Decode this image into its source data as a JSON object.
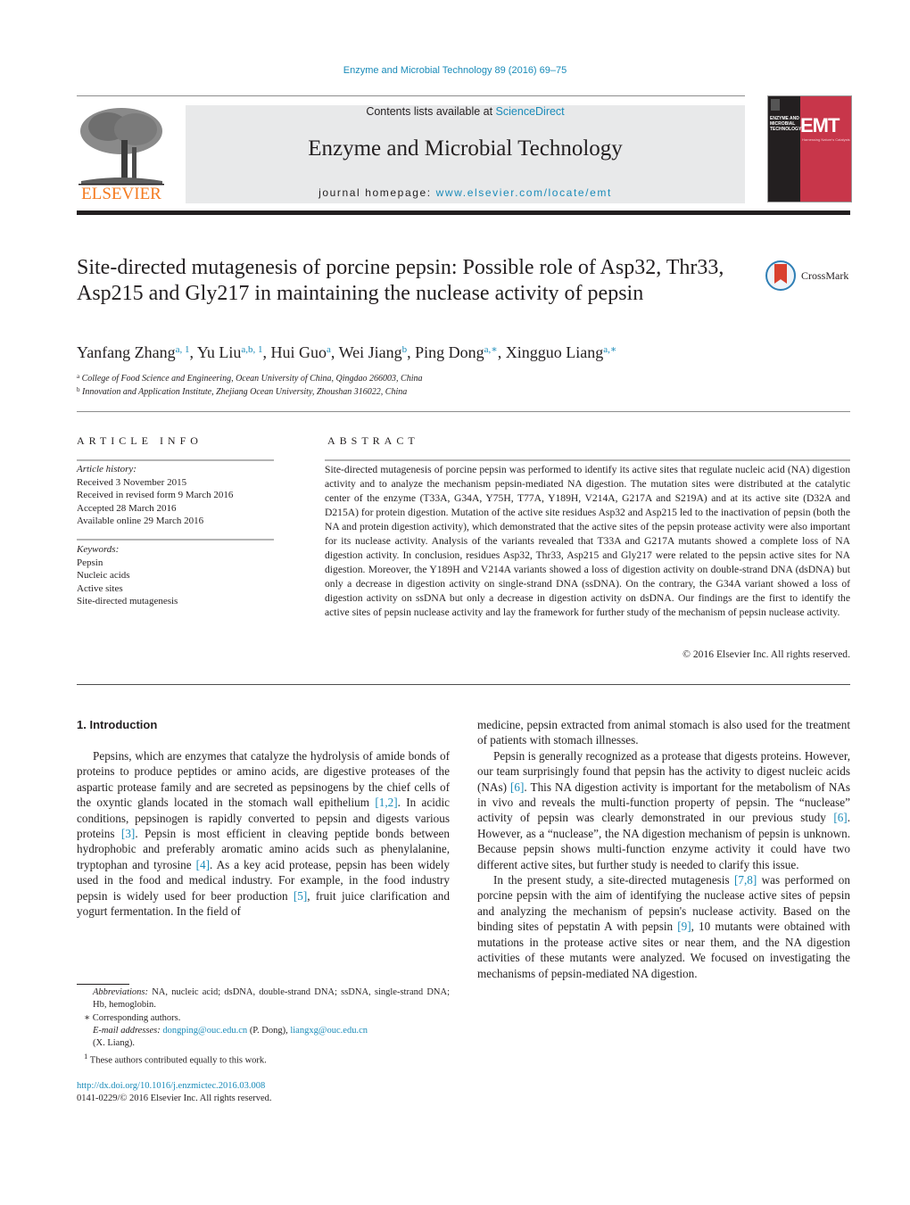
{
  "citation": "Enzyme and Microbial Technology 89 (2016) 69–75",
  "header": {
    "publisher_logo_text": "ELSEVIER",
    "contents_prefix": "Contents lists available at ",
    "contents_link": "ScienceDirect",
    "journal_name": "Enzyme and Microbial Technology",
    "homepage_prefix": "journal homepage: ",
    "homepage_link": "www.elsevier.com/locate/emt",
    "cover": {
      "abbrev": "EMT",
      "title_lines": "ENZYME AND MICROBIAL TECHNOLOGY",
      "tagline": "Harnessing Nature's Catalysts",
      "colors": {
        "left_panel": "#231f20",
        "right_panel": "#c8364a"
      }
    },
    "crossmark_label": "CrossMark"
  },
  "article": {
    "title": "Site-directed mutagenesis of porcine pepsin: Possible role of Asp32, Thr33, Asp215 and Gly217 in maintaining the nuclease activity of pepsin",
    "authors": [
      {
        "name": "Yanfang Zhang",
        "sup": "a, 1"
      },
      {
        "name": "Yu Liu",
        "sup": "a,b, 1"
      },
      {
        "name": "Hui Guo",
        "sup": "a"
      },
      {
        "name": "Wei Jiang",
        "sup": "b"
      },
      {
        "name": "Ping Dong",
        "sup": "a,∗"
      },
      {
        "name": "Xingguo Liang",
        "sup": "a,∗"
      }
    ],
    "affiliations": [
      {
        "mark": "a",
        "text": "College of Food Science and Engineering, Ocean University of China, Qingdao 266003, China"
      },
      {
        "mark": "b",
        "text": "Innovation and Application Institute, Zhejiang Ocean University, Zhoushan 316022, China"
      }
    ]
  },
  "article_info": {
    "heading": "ARTICLE INFO",
    "history_label": "Article history:",
    "history": [
      "Received 3 November 2015",
      "Received in revised form 9 March 2016",
      "Accepted 28 March 2016",
      "Available online 29 March 2016"
    ],
    "keywords_label": "Keywords:",
    "keywords": [
      "Pepsin",
      "Nucleic acids",
      "Active sites",
      "Site-directed mutagenesis"
    ]
  },
  "abstract": {
    "heading": "ABSTRACT",
    "text": "Site-directed mutagenesis of porcine pepsin was performed to identify its active sites that regulate nucleic acid (NA) digestion activity and to analyze the mechanism pepsin-mediated NA digestion. The mutation sites were distributed at the catalytic center of the enzyme (T33A, G34A, Y75H, T77A, Y189H, V214A, G217A and S219A) and at its active site (D32A and D215A) for protein digestion. Mutation of the active site residues Asp32 and Asp215 led to the inactivation of pepsin (both the NA and protein digestion activity), which demonstrated that the active sites of the pepsin protease activity were also important for its nuclease activity. Analysis of the variants revealed that T33A and G217A mutants showed a complete loss of NA digestion activity. In conclusion, residues Asp32, Thr33, Asp215 and Gly217 were related to the pepsin active sites for NA digestion. Moreover, the Y189H and V214A variants showed a loss of digestion activity on double-strand DNA (dsDNA) but only a decrease in digestion activity on single-strand DNA (ssDNA). On the contrary, the G34A variant showed a loss of digestion activity on ssDNA but only a decrease in digestion activity on dsDNA. Our findings are the first to identify the active sites of pepsin nuclease activity and lay the framework for further study of the mechanism of pepsin nuclease activity.",
    "copyright": "© 2016 Elsevier Inc. All rights reserved."
  },
  "body": {
    "section_heading": "1.  Introduction",
    "left_paragraphs": [
      [
        {
          "t": "Pepsins, which are enzymes that catalyze the hydrolysis of amide bonds of proteins to produce peptides or amino acids, are digestive proteases of the aspartic protease family and are secreted as pepsinogens by the chief cells of the oxyntic glands located in the stomach wall epithelium "
        },
        {
          "ref": "[1,2]"
        },
        {
          "t": ". In acidic conditions, pepsinogen is rapidly converted to pepsin and digests various proteins "
        },
        {
          "ref": "[3]"
        },
        {
          "t": ". Pepsin is most efficient in cleaving peptide bonds between hydrophobic and preferably aromatic amino acids such as phenylalanine, tryptophan and tyrosine "
        },
        {
          "ref": "[4]"
        },
        {
          "t": ". As a key acid protease, pepsin has been widely used in the food and medical industry. For example, in the food industry pepsin is widely used for beer production "
        },
        {
          "ref": "[5]"
        },
        {
          "t": ", fruit juice clarification and yogurt fermentation. In the field of"
        }
      ]
    ],
    "right_paragraphs": [
      [
        {
          "t": "medicine, pepsin extracted from animal stomach is also used for the treatment of patients with stomach illnesses."
        }
      ],
      [
        {
          "t": "Pepsin is generally recognized as a protease that digests proteins. However, our team surprisingly found that pepsin has the activity to digest nucleic acids (NAs) "
        },
        {
          "ref": "[6]"
        },
        {
          "t": ". This NA digestion activity is important for the metabolism of NAs in vivo and reveals the multi-function property of pepsin. The “nuclease” activity of pepsin was clearly demonstrated in our previous study "
        },
        {
          "ref": "[6]"
        },
        {
          "t": ". However, as a “nuclease”, the NA digestion mechanism of pepsin is unknown. Because pepsin shows multi-function enzyme activity it could have two different active sites, but further study is needed to clarify this issue."
        }
      ],
      [
        {
          "t": "In the present study, a site-directed mutagenesis "
        },
        {
          "ref": "[7,8]"
        },
        {
          "t": " was performed on porcine pepsin with the aim of identifying the nuclease active sites of pepsin and analyzing the mechanism of pepsin's nuclease activity. Based on the binding sites of pepstatin A with pepsin "
        },
        {
          "ref": "[9]"
        },
        {
          "t": ", 10 mutants were obtained with mutations in the protease active sites or near them, and the NA digestion activities of these mutants were analyzed. We focused on investigating the mechanisms of pepsin-mediated NA digestion."
        }
      ]
    ]
  },
  "footnotes": {
    "abbrev_label": "Abbreviations:",
    "abbrev_text": "  NA, nucleic acid; dsDNA, double-strand DNA; ssDNA, single-strand DNA; Hb, hemoglobin.",
    "corresponding_mark": "∗",
    "corresponding_text": " Corresponding authors.",
    "email_label": "E-mail addresses:",
    "email_1": "dongping@ouc.edu.cn",
    "email_1_name": " (P. Dong), ",
    "email_2": "liangxg@ouc.edu.cn",
    "email_2_name": "(X. Liang).",
    "equal_mark": "1",
    "equal_text": " These authors contributed equally to this work.",
    "doi": "http://dx.doi.org/10.1016/j.enzmictec.2016.03.008",
    "issn_line": "0141-0229/© 2016 Elsevier Inc. All rights reserved."
  },
  "colors": {
    "link": "#1a8bb9",
    "elsevier_orange": "#f47b20",
    "text": "#231f20",
    "header_box": "#e8e9ea"
  }
}
